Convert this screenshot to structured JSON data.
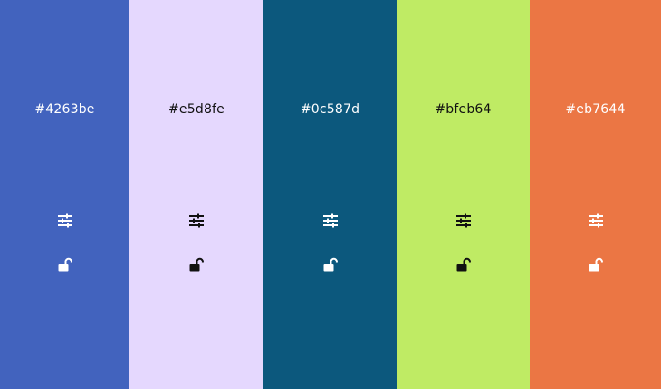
{
  "palette": {
    "swatches": [
      {
        "hex": "#4263be",
        "text_color": "#ffffff",
        "adjust_icon": "sliders-icon",
        "lock_icon": "unlock-icon"
      },
      {
        "hex": "#e5d8fe",
        "text_color": "#111111",
        "adjust_icon": "sliders-icon",
        "lock_icon": "unlock-icon"
      },
      {
        "hex": "#0c587d",
        "text_color": "#ffffff",
        "adjust_icon": "sliders-icon",
        "lock_icon": "unlock-icon"
      },
      {
        "hex": "#bfeb64",
        "text_color": "#111111",
        "adjust_icon": "sliders-icon",
        "lock_icon": "unlock-icon"
      },
      {
        "hex": "#eb7644",
        "text_color": "#ffffff",
        "adjust_icon": "sliders-icon",
        "lock_icon": "unlock-icon"
      }
    ]
  }
}
